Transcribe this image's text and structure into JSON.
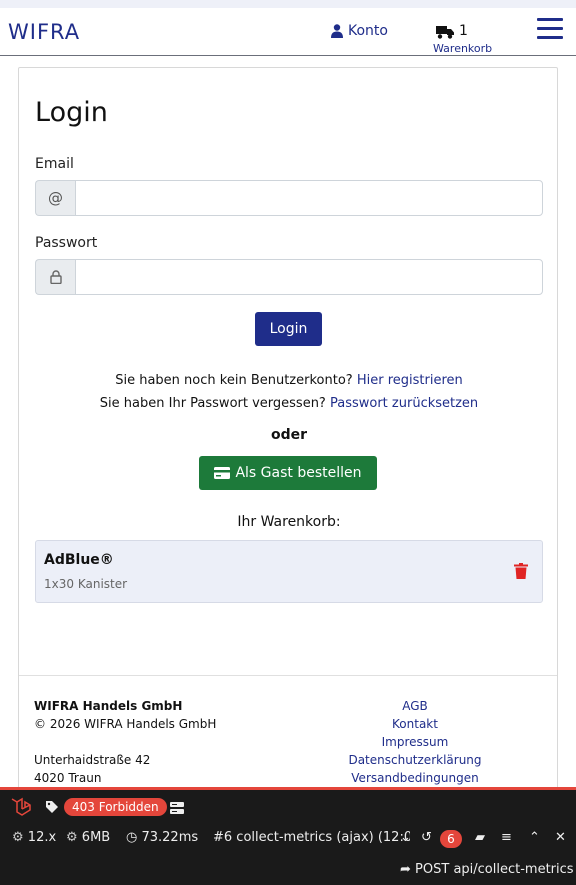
{
  "header": {
    "brand": "WIFRA",
    "account_label": "Konto",
    "cart_count": "1",
    "cart_label": "Warenkorb",
    "icons": {
      "account": "user-icon",
      "cart": "truck-icon",
      "menu": "hamburger-menu-icon"
    }
  },
  "login": {
    "title": "Login",
    "email_label": "Email",
    "email_value": "",
    "email_addon": "@",
    "password_label": "Passwort",
    "password_value": "",
    "submit_label": "Login"
  },
  "register": {
    "prefix": "Sie haben noch kein Benutzerkonto?",
    "link_here": "Hier",
    "link_register": "registrieren"
  },
  "reset": {
    "prefix": "Sie haben Ihr Passwort vergessen?",
    "link_password": "Passwort",
    "link_reset": "zurücksetzen"
  },
  "or_label": "oder",
  "guest_button": "Als Gast bestellen",
  "cart": {
    "title": "Ihr Warenkorb:",
    "items": [
      {
        "name": "AdBlue®",
        "qty": "1x30 Kanister"
      }
    ]
  },
  "footer": {
    "company": "WIFRA Handels GmbH",
    "copyright": "© 2026 WIFRA Handels GmbH",
    "street": "Unterhaidstraße 42",
    "city": "4020 Traun",
    "links": [
      "AGB",
      "Kontakt",
      "Impressum",
      "Datenschutzerklärung",
      "Versandbedingungen"
    ]
  },
  "debugbar": {
    "status_badge": "403 Forbidden",
    "version": "12.x",
    "memory": "6MB",
    "time": "73.22ms",
    "request_select": "#6 collect-metrics (ajax) (12:0",
    "history_count": "6",
    "request_line": "POST api/collect-metrics"
  },
  "colors": {
    "brand": "#1f2d8a",
    "guest_button": "#1d7a3a",
    "debug_accent": "#e4463b"
  }
}
